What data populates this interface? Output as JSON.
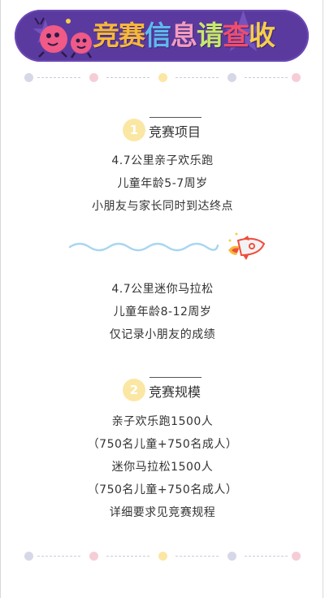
{
  "banner": {
    "title_chars": [
      {
        "char": "竞",
        "color": "#f6b73c"
      },
      {
        "char": "赛",
        "color": "#f6b73c"
      },
      {
        "char": "信",
        "color": "#5fb9ef"
      },
      {
        "char": "息",
        "color": "#f39cc0"
      },
      {
        "char": "请",
        "color": "#c7e86b"
      },
      {
        "char": "查",
        "color": "#ef4d6d"
      },
      {
        "char": "收",
        "color": "#f6cf4a"
      }
    ],
    "background_color": "#5b3aa0"
  },
  "divider_colors": [
    "#d6d8e8",
    "#f6cdd6",
    "#fbe7a4",
    "#d6d8e8",
    "#f6cdd6"
  ],
  "section1": {
    "number": "1",
    "heading": "竞赛项目",
    "group_a": [
      "4.7公里亲子欢乐跑",
      "儿童年龄5-7周岁",
      "小朋友与家长同时到达终点"
    ],
    "group_b": [
      "4.7公里迷你马拉松",
      "儿童年龄8-12周岁",
      "仅记录小朋友的成绩"
    ]
  },
  "section2": {
    "number": "2",
    "heading": "竞赛规模",
    "lines": [
      "亲子欢乐跑1500人",
      "（750名儿童+750名成人）",
      "迷你马拉松1500人",
      "（750名儿童+750名成人）",
      "详细要求见竞赛规程"
    ]
  },
  "icons": {
    "mascots": "pink-runner-characters-icon",
    "wave": "blue-wave-icon",
    "rocket": "rocket-icon"
  }
}
